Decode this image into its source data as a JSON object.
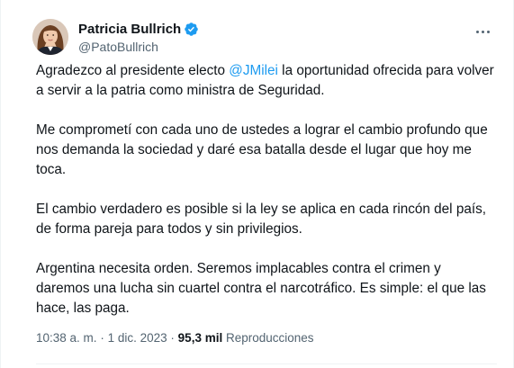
{
  "author": {
    "display_name": "Patricia Bullrich",
    "handle": "@PatoBullrich",
    "verified": true,
    "verified_color": "#1d9bf0"
  },
  "tweet": {
    "p1_before": "Agradezco al presidente electo ",
    "p1_mention": "@JMilei",
    "p1_after": " la oportunidad ofrecida para volver a servir a la patria como ministra de Seguridad.",
    "p2": "Me comprometí con cada uno de ustedes a lograr el cambio profundo que nos demanda la sociedad y daré esa batalla desde el lugar que hoy me toca.",
    "p3": "El cambio verdadero es posible si la ley se aplica en cada rincón del país, de forma pareja para todos y sin privilegios.",
    "p4": "Argentina necesita orden. Seremos implacables contra el crimen y daremos una lucha sin cuartel contra el narcotráfico. Es simple: el que las hace, las paga."
  },
  "meta": {
    "time": "10:38 a. m.",
    "separator": "·",
    "date": "1 dic. 2023",
    "views_count": "95,3 mil",
    "views_label": "Reproducciones"
  },
  "icons": {
    "verified": "verified-badge-icon",
    "more": "more-options-icon"
  },
  "colors": {
    "link": "#1d9bf0",
    "secondary_text": "#536471",
    "primary_text": "#0f1419"
  }
}
